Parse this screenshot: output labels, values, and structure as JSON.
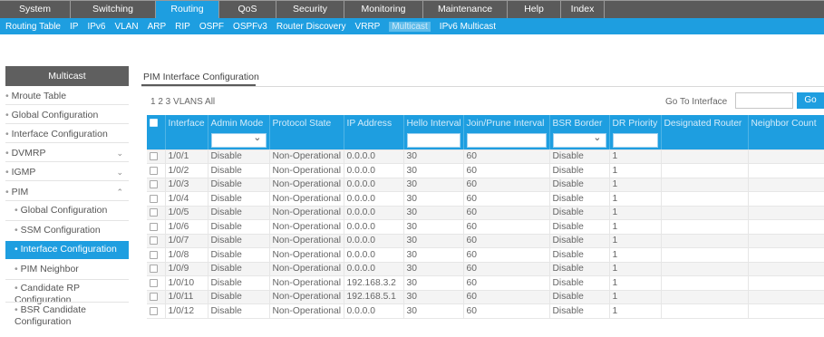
{
  "top_nav": [
    {
      "label": "System",
      "active": false
    },
    {
      "label": "Switching",
      "active": false
    },
    {
      "label": "Routing",
      "active": true
    },
    {
      "label": "QoS",
      "active": false
    },
    {
      "label": "Security",
      "active": false
    },
    {
      "label": "Monitoring",
      "active": false
    },
    {
      "label": "Maintenance",
      "active": false
    },
    {
      "label": "Help",
      "active": false
    },
    {
      "label": "Index",
      "active": false
    }
  ],
  "sub_nav": [
    {
      "label": "Routing Table",
      "active": false
    },
    {
      "label": "IP",
      "active": false
    },
    {
      "label": "IPv6",
      "active": false
    },
    {
      "label": "VLAN",
      "active": false
    },
    {
      "label": "ARP",
      "active": false
    },
    {
      "label": "RIP",
      "active": false
    },
    {
      "label": "OSPF",
      "active": false
    },
    {
      "label": "OSPFv3",
      "active": false
    },
    {
      "label": "Router Discovery",
      "active": false
    },
    {
      "label": "VRRP",
      "active": false
    },
    {
      "label": "Multicast",
      "active": true
    },
    {
      "label": "IPv6 Multicast",
      "active": false
    }
  ],
  "sidebar": {
    "header": "Multicast",
    "items": [
      {
        "label": "Mroute Table",
        "indent": 0,
        "chevron": ""
      },
      {
        "label": "Global Configuration",
        "indent": 0,
        "chevron": ""
      },
      {
        "label": "Interface Configuration",
        "indent": 0,
        "chevron": ""
      },
      {
        "label": "DVMRP",
        "indent": 0,
        "chevron": "⌄"
      },
      {
        "label": "IGMP",
        "indent": 0,
        "chevron": "⌄"
      },
      {
        "label": "PIM",
        "indent": 0,
        "chevron": "⌃"
      },
      {
        "label": "Global Configuration",
        "indent": 1,
        "chevron": ""
      },
      {
        "label": "SSM Configuration",
        "indent": 1,
        "chevron": ""
      },
      {
        "label": "Interface Configuration",
        "indent": 1,
        "chevron": "",
        "active": true
      },
      {
        "label": "PIM Neighbor",
        "indent": 1,
        "chevron": ""
      },
      {
        "label": "Candidate RP Configuration",
        "indent": 1,
        "chevron": ""
      },
      {
        "label": "BSR Candidate Configuration",
        "indent": 1,
        "chevron": ""
      }
    ]
  },
  "main": {
    "title": "PIM Interface Configuration",
    "pagination": "1 2 3 VLANS All",
    "goto_label": "Go To Interface",
    "goto_value": "",
    "goto_button": "Go"
  },
  "table": {
    "columns": [
      "",
      "Interface",
      "Admin Mode",
      "Protocol State",
      "IP Address",
      "Hello Interval",
      "Join/Prune Interval",
      "BSR Border",
      "DR Priority",
      "Designated Router",
      "Neighbor Count"
    ],
    "rows": [
      {
        "interface": "1/0/1",
        "admin_mode": "Disable",
        "protocol_state": "Non-Operational",
        "ip_address": "0.0.0.0",
        "hello_interval": "30",
        "join_prune_interval": "60",
        "bsr_border": "Disable",
        "dr_priority": "1",
        "designated_router": "",
        "neighbor_count": ""
      },
      {
        "interface": "1/0/2",
        "admin_mode": "Disable",
        "protocol_state": "Non-Operational",
        "ip_address": "0.0.0.0",
        "hello_interval": "30",
        "join_prune_interval": "60",
        "bsr_border": "Disable",
        "dr_priority": "1",
        "designated_router": "",
        "neighbor_count": ""
      },
      {
        "interface": "1/0/3",
        "admin_mode": "Disable",
        "protocol_state": "Non-Operational",
        "ip_address": "0.0.0.0",
        "hello_interval": "30",
        "join_prune_interval": "60",
        "bsr_border": "Disable",
        "dr_priority": "1",
        "designated_router": "",
        "neighbor_count": ""
      },
      {
        "interface": "1/0/4",
        "admin_mode": "Disable",
        "protocol_state": "Non-Operational",
        "ip_address": "0.0.0.0",
        "hello_interval": "30",
        "join_prune_interval": "60",
        "bsr_border": "Disable",
        "dr_priority": "1",
        "designated_router": "",
        "neighbor_count": ""
      },
      {
        "interface": "1/0/5",
        "admin_mode": "Disable",
        "protocol_state": "Non-Operational",
        "ip_address": "0.0.0.0",
        "hello_interval": "30",
        "join_prune_interval": "60",
        "bsr_border": "Disable",
        "dr_priority": "1",
        "designated_router": "",
        "neighbor_count": ""
      },
      {
        "interface": "1/0/6",
        "admin_mode": "Disable",
        "protocol_state": "Non-Operational",
        "ip_address": "0.0.0.0",
        "hello_interval": "30",
        "join_prune_interval": "60",
        "bsr_border": "Disable",
        "dr_priority": "1",
        "designated_router": "",
        "neighbor_count": ""
      },
      {
        "interface": "1/0/7",
        "admin_mode": "Disable",
        "protocol_state": "Non-Operational",
        "ip_address": "0.0.0.0",
        "hello_interval": "30",
        "join_prune_interval": "60",
        "bsr_border": "Disable",
        "dr_priority": "1",
        "designated_router": "",
        "neighbor_count": ""
      },
      {
        "interface": "1/0/8",
        "admin_mode": "Disable",
        "protocol_state": "Non-Operational",
        "ip_address": "0.0.0.0",
        "hello_interval": "30",
        "join_prune_interval": "60",
        "bsr_border": "Disable",
        "dr_priority": "1",
        "designated_router": "",
        "neighbor_count": ""
      },
      {
        "interface": "1/0/9",
        "admin_mode": "Disable",
        "protocol_state": "Non-Operational",
        "ip_address": "0.0.0.0",
        "hello_interval": "30",
        "join_prune_interval": "60",
        "bsr_border": "Disable",
        "dr_priority": "1",
        "designated_router": "",
        "neighbor_count": ""
      },
      {
        "interface": "1/0/10",
        "admin_mode": "Disable",
        "protocol_state": "Non-Operational",
        "ip_address": "192.168.3.2",
        "hello_interval": "30",
        "join_prune_interval": "60",
        "bsr_border": "Disable",
        "dr_priority": "1",
        "designated_router": "",
        "neighbor_count": ""
      },
      {
        "interface": "1/0/11",
        "admin_mode": "Disable",
        "protocol_state": "Non-Operational",
        "ip_address": "192.168.5.1",
        "hello_interval": "30",
        "join_prune_interval": "60",
        "bsr_border": "Disable",
        "dr_priority": "1",
        "designated_router": "",
        "neighbor_count": ""
      },
      {
        "interface": "1/0/12",
        "admin_mode": "Disable",
        "protocol_state": "Non-Operational",
        "ip_address": "0.0.0.0",
        "hello_interval": "30",
        "join_prune_interval": "60",
        "bsr_border": "Disable",
        "dr_priority": "1",
        "designated_router": "",
        "neighbor_count": ""
      }
    ]
  },
  "colors": {
    "accent_blue": "#1e9ee0",
    "nav_gray": "#5a5a5a"
  }
}
